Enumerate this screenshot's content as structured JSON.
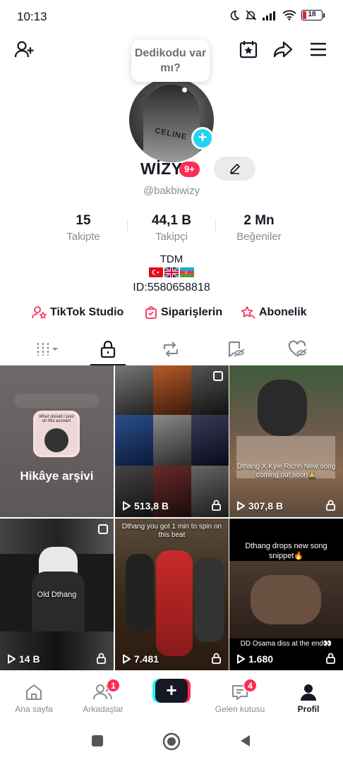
{
  "status_bar": {
    "time": "10:13",
    "battery": "18"
  },
  "profile": {
    "bubble_text": "Dedikodu var mı?",
    "username": "WİZY",
    "badge": "9+",
    "handle": "@bakbiwizy",
    "stats": [
      {
        "value": "15",
        "label": "Takipte"
      },
      {
        "value": "44,1 B",
        "label": "Takipçi"
      },
      {
        "value": "2 Mn",
        "label": "Beğeniler"
      }
    ],
    "bio_line1": "TDM",
    "bio_id": "ID:5580658818"
  },
  "links": {
    "studio": "TikTok Studio",
    "orders": "Siparişlerin",
    "subscription": "Abonelik"
  },
  "grid": {
    "story_archive": "Hikâye arşivi",
    "story_thumb_text": "What should I post on this account",
    "videos": [
      {
        "views": "513,8 B",
        "caption": ""
      },
      {
        "views": "307,8 B",
        "caption": "Dthang X Kyle Richh New song coming out soon🙏"
      },
      {
        "views": "14 B",
        "caption": "Old Dthang"
      },
      {
        "views": "7.481",
        "caption": "Dthang you got 1 min to spin on this beat"
      },
      {
        "views": "1.680",
        "caption_top": "Dthang drops new song snippet🔥",
        "caption": "DD Osama diss at the end👀"
      }
    ]
  },
  "bottom_nav": {
    "home": "Ana sayfa",
    "friends": "Arkadaşlar",
    "friends_badge": "1",
    "create": "+",
    "inbox": "Gelen kutusu",
    "inbox_badge": "4",
    "profile": "Profil"
  },
  "colors": {
    "accent": "#fe2c55",
    "cyan": "#25f4ee",
    "text": "#161823",
    "muted": "#8a8b91"
  }
}
